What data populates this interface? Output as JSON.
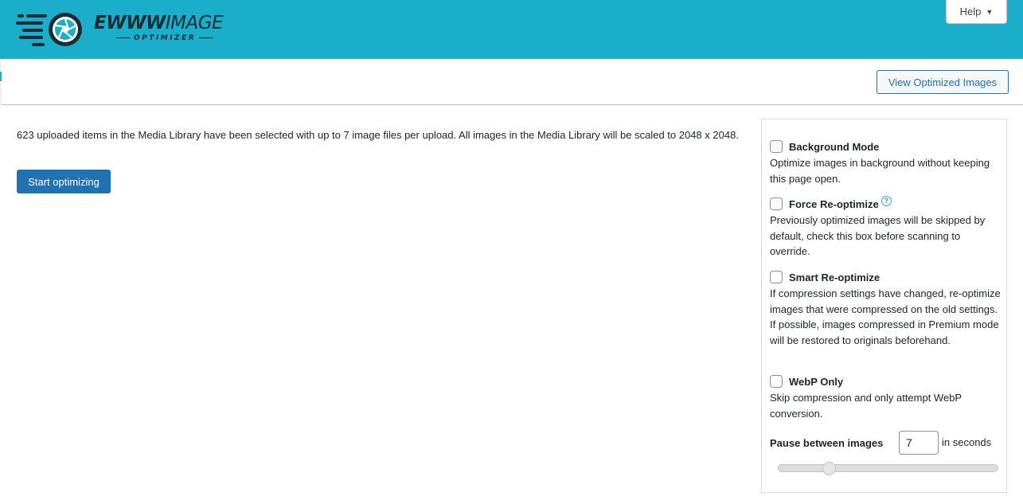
{
  "header": {
    "logo_main": "EWWW",
    "logo_secondary": "IMAGE",
    "logo_sub": "OPTIMIZER",
    "help_label": "Help",
    "help_caret": "▼",
    "bg_color": "#1aaecb"
  },
  "toolbar": {
    "view_optimized_label": "View Optimized Images"
  },
  "main": {
    "intro_text": "623 uploaded items in the Media Library have been selected with up to 7 image files per upload. All images in the Media Library will be scaled to 2048 x 2048.",
    "start_label": "Start optimizing"
  },
  "options": {
    "background_mode": {
      "title": "Background Mode",
      "desc": "Optimize images in background without keeping this page open.",
      "checked": false
    },
    "force_reoptimize": {
      "title": "Force Re-optimize",
      "help_icon": "?",
      "desc": "Previously optimized images will be skipped by default, check this box before scanning to override.",
      "checked": false
    },
    "smart_reoptimize": {
      "title": "Smart Re-optimize",
      "desc": "If compression settings have changed, re-optimize images that were compressed on the old settings. If possible, images compressed in Premium mode will be restored to originals beforehand.",
      "checked": false
    },
    "webp_only": {
      "title": "WebP Only",
      "desc": "Skip compression and only attempt WebP conversion.",
      "checked": false
    },
    "pause": {
      "label": "Pause between images",
      "value": "7",
      "unit": "in seconds",
      "slider_fraction": 0.23
    }
  },
  "colors": {
    "accent": "#2271b1",
    "brand": "#1aaecb"
  }
}
